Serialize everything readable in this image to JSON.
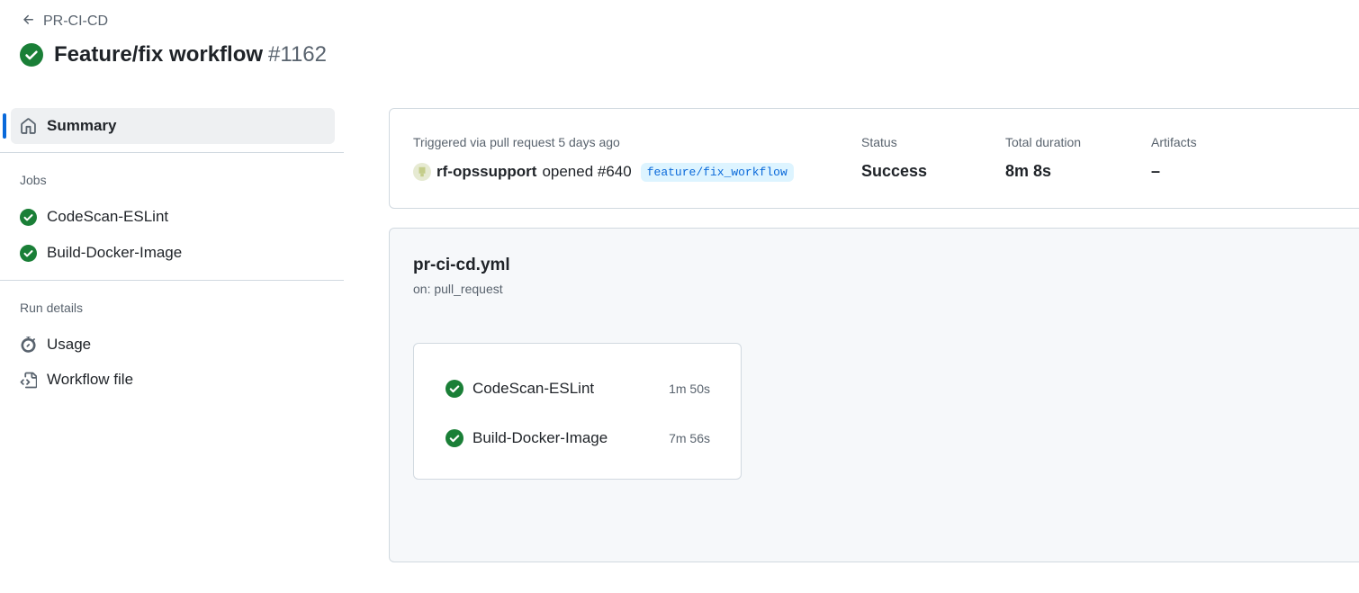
{
  "header": {
    "back_label": "PR-CI-CD",
    "title": "Feature/fix workflow",
    "run_number": "#1162"
  },
  "sidebar": {
    "summary_label": "Summary",
    "jobs_heading": "Jobs",
    "jobs": [
      {
        "label": "CodeScan-ESLint"
      },
      {
        "label": "Build-Docker-Image"
      }
    ],
    "run_details_heading": "Run details",
    "run_details": [
      {
        "label": "Usage"
      },
      {
        "label": "Workflow file"
      }
    ]
  },
  "summary": {
    "trigger_label": "Triggered via pull request 5 days ago",
    "actor": "rf-opssupport",
    "action": "opened #640",
    "branch": "feature/fix_workflow",
    "status_label": "Status",
    "status_value": "Success",
    "duration_label": "Total duration",
    "duration_value": "8m 8s",
    "artifacts_label": "Artifacts",
    "artifacts_value": "–"
  },
  "workflow": {
    "file": "pr-ci-cd.yml",
    "trigger": "on: pull_request",
    "jobs": [
      {
        "name": "CodeScan-ESLint",
        "duration": "1m 50s"
      },
      {
        "name": "Build-Docker-Image",
        "duration": "7m 56s"
      }
    ]
  },
  "colors": {
    "success": "#1a7f37",
    "accent": "#0969da",
    "muted": "#59636e",
    "border": "#d1d9e0"
  }
}
